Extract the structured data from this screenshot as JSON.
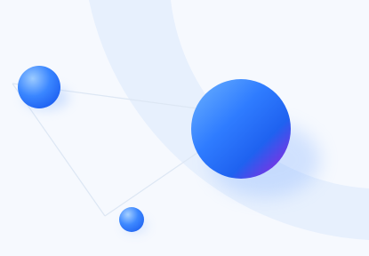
{
  "colors": {
    "background": "#f6f9fe",
    "arc": "#e7f0fd",
    "connector_line": "#dde7f4",
    "sphere_light": "#8ec3ff",
    "sphere_mid": "#2f7cff",
    "sphere_dark": "#1f5ef0",
    "sphere_accent": "#8a2be2"
  },
  "illustration": {
    "elements": [
      "decorative-arc",
      "connector-lines",
      "small-sphere-left",
      "large-sphere",
      "small-sphere-bottom"
    ]
  }
}
